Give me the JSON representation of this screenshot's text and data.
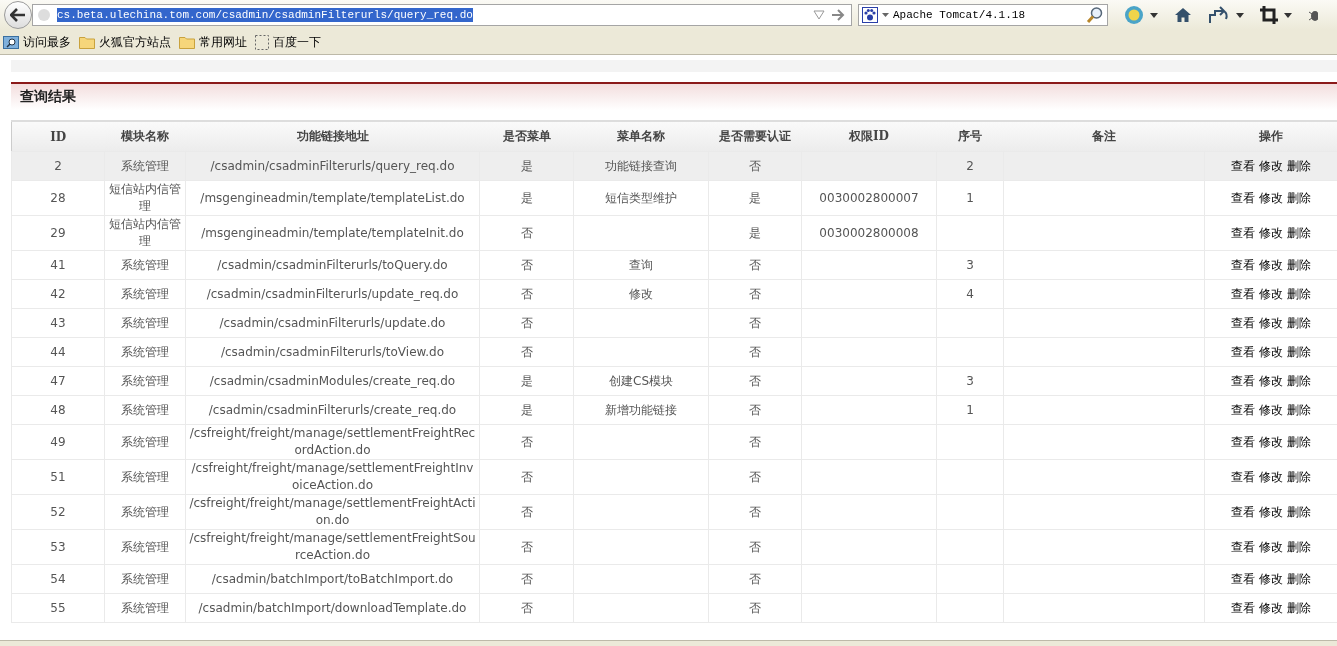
{
  "browser": {
    "address": "cs.beta.ulechina.tom.com/csadmin/csadminFilterurls/query_req.do",
    "address_selected": true,
    "search_engine_text": "Apache Tomcat/4.1.18"
  },
  "bookmarks": [
    {
      "label": "访问最多",
      "kind": "smart"
    },
    {
      "label": "火狐官方站点",
      "kind": "folder"
    },
    {
      "label": "常用网址",
      "kind": "folder"
    },
    {
      "label": "百度一下",
      "kind": "page"
    }
  ],
  "section_title": "查询结果",
  "table": {
    "columns": [
      "ID",
      "模块名称",
      "功能链接地址",
      "是否菜单",
      "菜单名称",
      "是否需要认证",
      "权限ID",
      "序号",
      "备注",
      "操作"
    ],
    "rows": [
      {
        "selected": true,
        "cells": [
          "2",
          "系统管理",
          "/csadmin/csadminFilterurls/query_req.do",
          "是",
          "功能链接查询",
          "否",
          "",
          "2",
          ""
        ],
        "actions": [
          "查看",
          "修改",
          "删除"
        ]
      },
      {
        "selected": false,
        "cells": [
          "28",
          "短信站内信管理",
          "/msgengineadmin/template/templateList.do",
          "是",
          "短信类型维护",
          "是",
          "0030002800007",
          "1",
          ""
        ],
        "actions": [
          "查看",
          "修改",
          "删除"
        ]
      },
      {
        "selected": false,
        "cells": [
          "29",
          "短信站内信管理",
          "/msgengineadmin/template/templateInit.do",
          "否",
          "",
          "是",
          "0030002800008",
          "",
          ""
        ],
        "actions": [
          "查看",
          "修改",
          "删除"
        ]
      },
      {
        "selected": false,
        "cells": [
          "41",
          "系统管理",
          "/csadmin/csadminFilterurls/toQuery.do",
          "否",
          "查询",
          "否",
          "",
          "3",
          ""
        ],
        "actions": [
          "查看",
          "修改",
          "删除"
        ]
      },
      {
        "selected": false,
        "cells": [
          "42",
          "系统管理",
          "/csadmin/csadminFilterurls/update_req.do",
          "否",
          "修改",
          "否",
          "",
          "4",
          ""
        ],
        "actions": [
          "查看",
          "修改",
          "删除"
        ]
      },
      {
        "selected": false,
        "cells": [
          "43",
          "系统管理",
          "/csadmin/csadminFilterurls/update.do",
          "否",
          "",
          "否",
          "",
          "",
          ""
        ],
        "actions": [
          "查看",
          "修改",
          "删除"
        ]
      },
      {
        "selected": false,
        "cells": [
          "44",
          "系统管理",
          "/csadmin/csadminFilterurls/toView.do",
          "否",
          "",
          "否",
          "",
          "",
          ""
        ],
        "actions": [
          "查看",
          "修改",
          "删除"
        ]
      },
      {
        "selected": false,
        "cells": [
          "47",
          "系统管理",
          "/csadmin/csadminModules/create_req.do",
          "是",
          "创建CS模块",
          "否",
          "",
          "3",
          ""
        ],
        "actions": [
          "查看",
          "修改",
          "删除"
        ]
      },
      {
        "selected": false,
        "cells": [
          "48",
          "系统管理",
          "/csadmin/csadminFilterurls/create_req.do",
          "是",
          "新增功能链接",
          "否",
          "",
          "1",
          ""
        ],
        "actions": [
          "查看",
          "修改",
          "删除"
        ]
      },
      {
        "selected": false,
        "cells": [
          "49",
          "系统管理",
          "/csfreight/freight/manage/settlementFreightRecordAction.do",
          "否",
          "",
          "否",
          "",
          "",
          ""
        ],
        "actions": [
          "查看",
          "修改",
          "删除"
        ]
      },
      {
        "selected": false,
        "cells": [
          "51",
          "系统管理",
          "/csfreight/freight/manage/settlementFreightInvoiceAction.do",
          "否",
          "",
          "否",
          "",
          "",
          ""
        ],
        "actions": [
          "查看",
          "修改",
          "删除"
        ]
      },
      {
        "selected": false,
        "cells": [
          "52",
          "系统管理",
          "/csfreight/freight/manage/settlementFreightAction.do",
          "否",
          "",
          "否",
          "",
          "",
          ""
        ],
        "actions": [
          "查看",
          "修改",
          "删除"
        ]
      },
      {
        "selected": false,
        "cells": [
          "53",
          "系统管理",
          "/csfreight/freight/manage/settlementFreightSourceAction.do",
          "否",
          "",
          "否",
          "",
          "",
          ""
        ],
        "actions": [
          "查看",
          "修改",
          "删除"
        ]
      },
      {
        "selected": false,
        "cells": [
          "54",
          "系统管理",
          "/csadmin/batchImport/toBatchImport.do",
          "否",
          "",
          "否",
          "",
          "",
          ""
        ],
        "actions": [
          "查看",
          "修改",
          "删除"
        ]
      },
      {
        "selected": false,
        "cells": [
          "55",
          "系统管理",
          "/csadmin/batchImport/downloadTemplate.do",
          "否",
          "",
          "否",
          "",
          "",
          ""
        ],
        "actions": [
          "查看",
          "修改",
          "删除"
        ]
      }
    ]
  }
}
